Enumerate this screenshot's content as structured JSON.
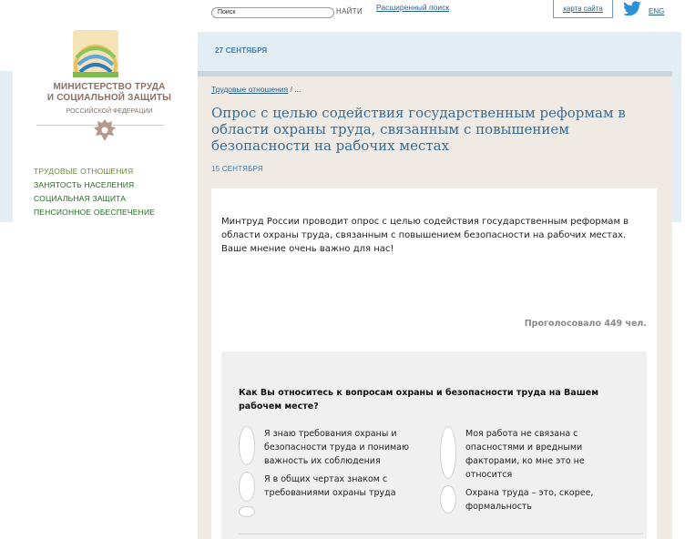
{
  "header": {
    "search_placeholder": "Поиск",
    "search_button": "НАЙТИ",
    "advanced_search": "Расширенный поиск",
    "sitemap": "карта сайта",
    "lang": "ENG",
    "date": "27 СЕНТЯБРЯ"
  },
  "sidebar": {
    "ministry_line1": "МИНИСТЕРСТВО ТРУДА",
    "ministry_line2": "И СОЦИАЛЬНОЙ ЗАЩИТЫ",
    "ministry_sub": "РОССИЙСКОЙ ФЕДЕРАЦИИ",
    "nav": [
      {
        "label": "ТРУДОВЫЕ ОТНОШЕНИЯ"
      },
      {
        "label": "ЗАНЯТОСТЬ НАСЕЛЕНИЯ"
      },
      {
        "label": "СОЦИАЛЬНАЯ ЗАЩИТА"
      },
      {
        "label": "ПЕНСИОННОЕ ОБЕСПЕЧЕНИЕ"
      }
    ]
  },
  "breadcrumb": {
    "link": "Трудовые отношения",
    "sep": " / ..."
  },
  "article": {
    "title": "Опрос с целью содействия государственным реформам в области охраны труда, связанным с повышением безопасности на рабочих местах",
    "date": "15 СЕНТЯБРЯ",
    "intro": "Минтруд России проводит опрос с целью содействия государственным реформам в области охраны труда, связанным с повышением безопасности на рабочих местах. Ваше мнение очень важно для нас!",
    "votes": "Проголосовало 449 чел."
  },
  "poll": {
    "question": "Как Вы относитесь к вопросам охраны и безопасности труда на Вашем рабочем месте?",
    "options": [
      {
        "label": "Я знаю требования охраны и безопасности труда и понимаю важность их соблюдения"
      },
      {
        "label": "Моя работа не связана с опасностями и вредными факторами, ко мне это не относится"
      },
      {
        "label": "Я в общих чертах знаком с требованиями охраны труда"
      },
      {
        "label": "Охрана труда – это, скорее, формальность"
      }
    ]
  },
  "colors": {
    "header_band": "#e3edf4",
    "content_bg": "#efebe4",
    "link_blue": "#2b5f8c",
    "nav_green": "#1f6b1f",
    "ministry_brown": "#8c6e63"
  }
}
